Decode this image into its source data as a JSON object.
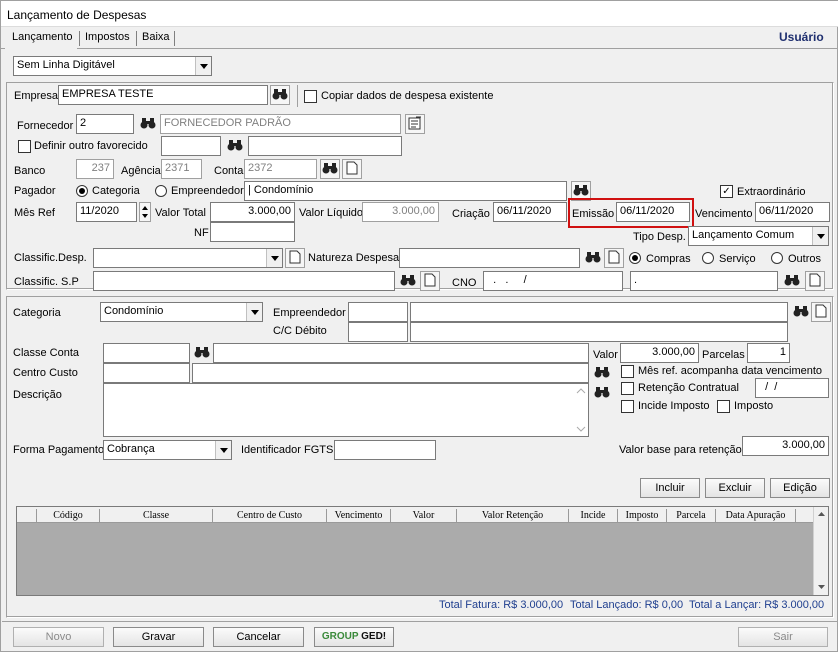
{
  "window": {
    "title": "Lançamento de Despesas",
    "user": "Usuário"
  },
  "tabs": [
    "Lançamento",
    "Impostos",
    "Baixa"
  ],
  "top_select": "Sem Linha Digitável",
  "empresa": {
    "label": "Empresa",
    "value": "EMPRESA TESTE",
    "copy_label": "Copiar dados de despesa existente"
  },
  "fornecedor": {
    "label": "Fornecedor",
    "code": "2",
    "name": "FORNECEDOR PADRÃO"
  },
  "favorecido": {
    "label": "Definir outro favorecido"
  },
  "banco": {
    "label": "Banco",
    "value": "237",
    "agencia_label": "Agência",
    "agencia": "2371",
    "conta_label": "Conta",
    "conta": "2372"
  },
  "pagador": {
    "label": "Pagador",
    "opt1": "Categoria",
    "opt2": "Empreendedor",
    "value": "| Condomínio",
    "extra_label": "Extraordinário"
  },
  "valores": {
    "mesref_label": "Mês Ref",
    "mesref": "11/2020",
    "total_label": "Valor Total",
    "total": "3.000,00",
    "liquido_label": "Valor Líquido",
    "liquido": "3.000,00",
    "criacao_label": "Criação",
    "criacao": "06/11/2020",
    "emissao_label": "Emissão",
    "emissao": "06/11/2020",
    "venc_label": "Vencimento",
    "venc": "06/11/2020"
  },
  "nf": {
    "label": "NF",
    "tipo_label": "Tipo Desp.",
    "tipo": "Lançamento Comum"
  },
  "classif": {
    "desp_label": "Classific.Desp.",
    "natureza_label": "Natureza Despesa",
    "opt1": "Compras",
    "opt2": "Serviço",
    "opt3": "Outros",
    "sp_label": "Classific. S.P",
    "cno_label": "CNO",
    "cno": "  .   .     /",
    "cno2": "."
  },
  "detail": {
    "categoria_label": "Categoria",
    "categoria": "Condomínio",
    "empreendedor_label": "Empreendedor",
    "ccdebito_label": "C/C Débito",
    "classe_label": "Classe Conta",
    "valor_label": "Valor",
    "valor": "3.000,00",
    "parcelas_label": "Parcelas",
    "parcelas": "1",
    "centro_label": "Centro Custo",
    "mesref_chk": "Mês ref. acompanha data vencimento",
    "retencao_chk": "Retenção Contratual",
    "retencao_date": "  /  /",
    "incide_chk": "Incide Imposto",
    "imposto_chk": "Imposto",
    "descricao_label": "Descrição",
    "forma_label": "Forma Pagamento",
    "forma": "Cobrança",
    "fgts_label": "Identificador FGTS",
    "base_label": "Valor base para retenção",
    "base": "3.000,00"
  },
  "grid_buttons": {
    "incluir": "Incluir",
    "excluir": "Excluir",
    "edicao": "Edição"
  },
  "grid_cols": [
    "Código",
    "Classe",
    "Centro de Custo",
    "Vencimento",
    "Valor",
    "Valor Retenção",
    "Incide",
    "Imposto",
    "Parcela",
    "Data Apuração"
  ],
  "totals": {
    "fatura": "Total Fatura: R$ 3.000,00",
    "lancado": "Total Lançado: R$ 0,00",
    "alancar": "Total a Lançar: R$ 3.000,00"
  },
  "footer": {
    "novo": "Novo",
    "gravar": "Gravar",
    "cancelar": "Cancelar",
    "ged_a": "GROUP",
    "ged_b": "GED!",
    "sair": "Sair"
  }
}
